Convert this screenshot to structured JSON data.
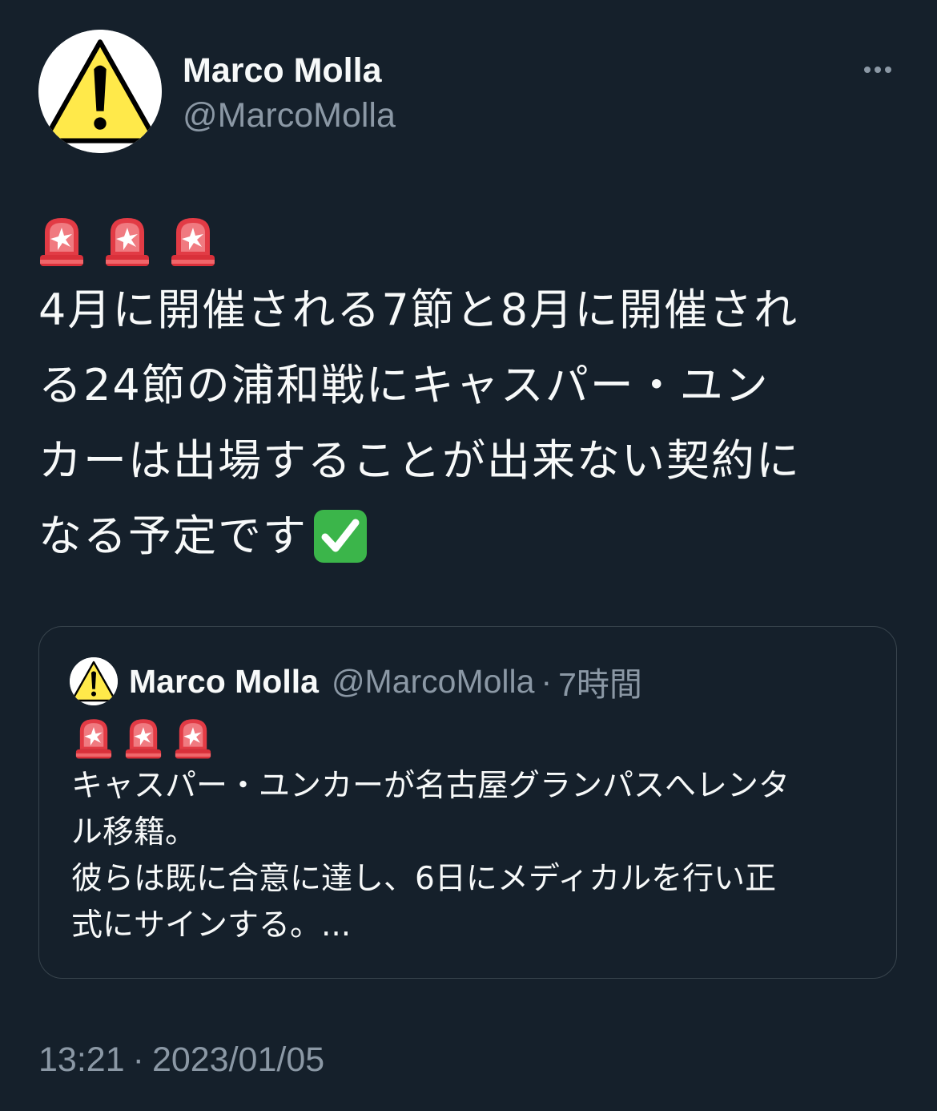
{
  "author": {
    "display_name": "Marco Molla",
    "handle": "@MarcoMolla",
    "avatar_icon": "warning-sign-icon"
  },
  "more_icon": "more-horizontal-icon",
  "tweet": {
    "emoji": [
      "police-car-light-emoji",
      "police-car-light-emoji",
      "police-car-light-emoji"
    ],
    "lines": [
      "4月に開催される7節と8月に開催され",
      "る24節の浦和戦にキャスパー・ユン",
      "カーは出場することが出来ない契約に",
      "なる予定です"
    ],
    "trailing_emoji": "check-mark-button-emoji"
  },
  "quoted_tweet": {
    "display_name": "Marco Molla",
    "handle": "@MarcoMolla",
    "separator": "·",
    "time": "7時間",
    "emoji": [
      "police-car-light-emoji",
      "police-car-light-emoji",
      "police-car-light-emoji"
    ],
    "lines": [
      "キャスパー・ユンカーが名古屋グランパスへレンタ",
      "ル移籍。",
      "彼らは既に合意に達し、6日にメディカルを行い正",
      "式にサインする。..."
    ]
  },
  "timestamp": {
    "time": "13:21",
    "separator": "·",
    "date": "2023/01/05"
  },
  "colors": {
    "background": "#15202b",
    "primary_text": "#f7f9f9",
    "secondary_text": "#8b98a5",
    "border": "#38444d",
    "warning_yellow": "#ffe94a",
    "check_green": "#3bb54a"
  }
}
